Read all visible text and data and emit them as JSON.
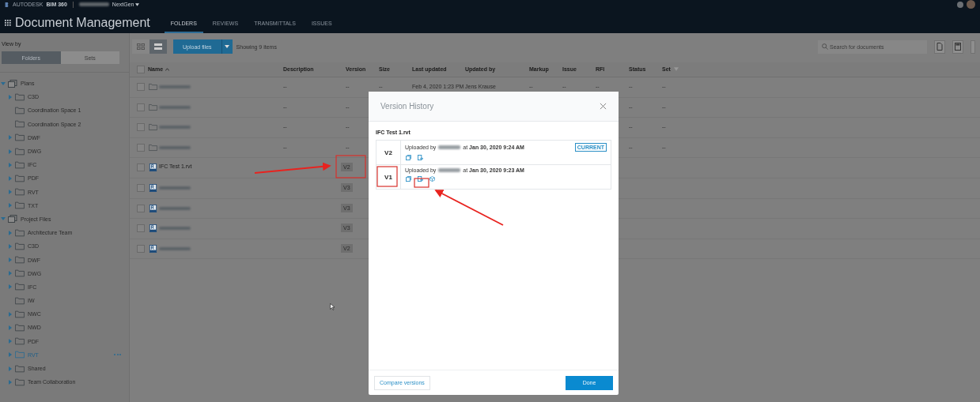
{
  "header": {
    "brand": "AUTODESK",
    "product": "BIM 360",
    "project": "NextGen",
    "title": "Document Management",
    "tabs": [
      {
        "label": "FOLDERS",
        "selected": true
      },
      {
        "label": "REVIEWS",
        "selected": false
      },
      {
        "label": "TRANSMITTALS",
        "selected": false
      },
      {
        "label": "ISSUES",
        "selected": false
      }
    ]
  },
  "sidebar": {
    "view_by": "View by",
    "toggle": [
      {
        "label": "Folders",
        "selected": true
      },
      {
        "label": "Sets",
        "selected": false
      }
    ],
    "tree": [
      {
        "label": "Plans",
        "expanded": true,
        "selected": false,
        "children": [
          {
            "label": "C3D",
            "kind": "folder",
            "selected": false
          },
          {
            "label": "Coordination Space 1",
            "kind": "leaf",
            "selected": false
          },
          {
            "label": "Coordination Space 2",
            "kind": "leaf",
            "selected": false
          },
          {
            "label": "DWF",
            "kind": "folder",
            "selected": false
          },
          {
            "label": "DWG",
            "kind": "folder",
            "selected": false
          },
          {
            "label": "IFC",
            "kind": "folder",
            "selected": false
          },
          {
            "label": "PDF",
            "kind": "folder",
            "selected": false
          },
          {
            "label": "RVT",
            "kind": "folder",
            "selected": false
          },
          {
            "label": "TXT",
            "kind": "folder",
            "selected": false
          }
        ]
      },
      {
        "label": "Project Files",
        "expanded": true,
        "selected": false,
        "children": [
          {
            "label": "Architecture Team",
            "kind": "folder",
            "selected": false
          },
          {
            "label": "C3D",
            "kind": "folder",
            "selected": false
          },
          {
            "label": "DWF",
            "kind": "folder",
            "selected": false
          },
          {
            "label": "DWG",
            "kind": "folder",
            "selected": false
          },
          {
            "label": "IFC",
            "kind": "folder",
            "selected": false
          },
          {
            "label": "IW",
            "kind": "leaf",
            "selected": false
          },
          {
            "label": "NWC",
            "kind": "folder",
            "selected": false
          },
          {
            "label": "NWD",
            "kind": "folder",
            "selected": false
          },
          {
            "label": "PDF",
            "kind": "folder",
            "selected": false
          },
          {
            "label": "RVT",
            "kind": "folder",
            "selected": true
          },
          {
            "label": "Shared",
            "kind": "folder",
            "selected": false
          },
          {
            "label": "Team Collaboration",
            "kind": "folder",
            "selected": false
          }
        ]
      }
    ]
  },
  "toolbar": {
    "upload": "Upload files",
    "count": "Showing 9 items",
    "search": {
      "placeholder": "Search for documents"
    }
  },
  "table": {
    "select_all": {
      "checked": false
    },
    "columns": [
      "Name",
      "Description",
      "Version",
      "Size",
      "Last updated",
      "Updated by",
      "Markup",
      "Issue",
      "RFI",
      "Status",
      "Set"
    ],
    "rows": [
      {
        "kind": "folder",
        "checked": false,
        "cells": {
          "description": "--",
          "version": "--",
          "size": "--",
          "updated": "Feb 4, 2020 1:23 PM",
          "by": "Jens Krause",
          "markup": "--",
          "issue": "--",
          "rfi": "--",
          "status": "--",
          "set": "--"
        }
      },
      {
        "kind": "folder",
        "checked": false,
        "cells": {
          "description": "--",
          "version": "--",
          "status": "--",
          "set": "--"
        }
      },
      {
        "kind": "folder",
        "checked": false,
        "cells": {
          "description": "--",
          "version": "--",
          "status": "--",
          "set": "--"
        }
      },
      {
        "kind": "folder",
        "checked": false,
        "cells": {
          "description": "--",
          "version": "--",
          "status": "--",
          "set": "--"
        }
      },
      {
        "kind": "file",
        "checked": false,
        "name": "IFC Test 1.rvt",
        "cells": {
          "version": "V2"
        }
      },
      {
        "kind": "file",
        "checked": false,
        "cells": {
          "version": "V3"
        }
      },
      {
        "kind": "file",
        "checked": false,
        "cells": {
          "version": "V3"
        }
      },
      {
        "kind": "file",
        "checked": false,
        "cells": {
          "version": "V3"
        }
      },
      {
        "kind": "file",
        "checked": false,
        "cells": {
          "version": "V2"
        }
      }
    ]
  },
  "dialog": {
    "title": "Version History",
    "file": "IFC Test 1.rvt",
    "versions": [
      {
        "label": "V2",
        "prefix": "Uploaded by",
        "when": "at **Jan 30, 2020 9:24 AM**",
        "current": true,
        "badge": "CURRENT",
        "model_view": false
      },
      {
        "label": "V1",
        "prefix": "Uploaded by",
        "when": "at **Jan 30, 2020 9:23 AM**",
        "current": false,
        "model_view": true
      }
    ],
    "compare": "Compare versions",
    "done": "Done"
  }
}
